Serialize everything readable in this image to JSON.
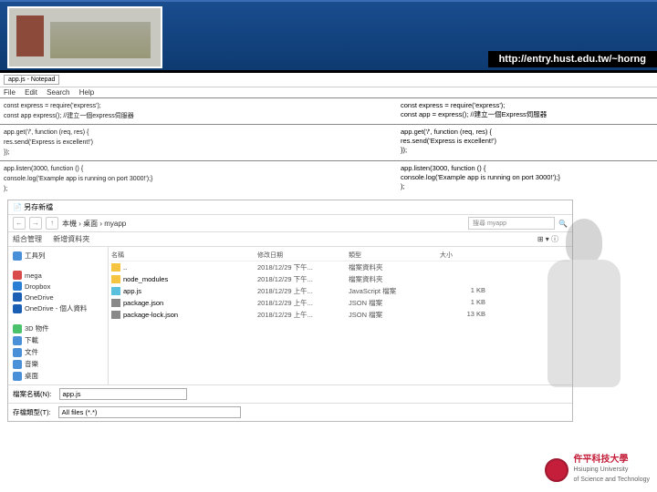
{
  "header": {
    "url": "http://entry.hust.edu.tw/~horng"
  },
  "editor": {
    "tab": "app.js - Notepad",
    "menu": [
      "File",
      "Edit",
      "Search",
      "Help"
    ],
    "codeLeft": [
      "const express = require('express');",
      "const app     express(); //建立一個express伺服器",
      "",
      "app.get('/', function (req, res) {",
      "  res.send('Express is excellent!')",
      "});",
      "",
      "app.listen(3000, function () {",
      "  console.log('Example app is running on port 3000!');}",
      ");"
    ],
    "codeRight": [
      "const express = require('express');",
      "const app = express(); //建立一個Express伺服器",
      "",
      "app.get('/', function (req, res) {",
      "  res.send('Express is excellent!')",
      "});",
      "",
      "app.listen(3000, function () {",
      "  console.log('Example app is running on port 3000!');}",
      ");"
    ]
  },
  "fe": {
    "title": "另存新檔",
    "breadcrumb": "本機 › 桌面 › myapp",
    "searchPlaceholder": "搜尋 myapp",
    "navItems": [
      "組合管理",
      "新增資料夾"
    ],
    "sidebar": [
      {
        "label": "工具列",
        "icon": "#4a90d9"
      },
      {
        "label": "mega",
        "icon": "#d94a4a"
      },
      {
        "label": "Dropbox",
        "icon": "#2a7fd4"
      },
      {
        "label": "OneDrive",
        "icon": "#1a5fb4"
      },
      {
        "label": "OneDrive - 個人資料",
        "icon": "#1a5fb4"
      },
      {
        "label": "3D 物件",
        "icon": "#4ac26b"
      },
      {
        "label": "下載",
        "icon": "#4a90d9"
      },
      {
        "label": "文件",
        "icon": "#4a90d9"
      },
      {
        "label": "音樂",
        "icon": "#4a90d9"
      },
      {
        "label": "桌面",
        "icon": "#4a90d9"
      }
    ],
    "columns": [
      "名稱",
      "修改日期",
      "類型",
      "大小"
    ],
    "files": [
      {
        "name": "..",
        "date": "2018/12/29 下午...",
        "type": "檔案資料夾",
        "size": "",
        "icon": "#f5c542"
      },
      {
        "name": "node_modules",
        "date": "2018/12/29 下午...",
        "type": "檔案資料夾",
        "size": "",
        "icon": "#f5c542"
      },
      {
        "name": "app.js",
        "date": "2018/12/29 上午...",
        "type": "JavaScript 檔案",
        "size": "1 KB",
        "icon": "#5bc0de"
      },
      {
        "name": "package.json",
        "date": "2018/12/29 上午...",
        "type": "JSON 檔案",
        "size": "1 KB",
        "icon": "#888"
      },
      {
        "name": "package-lock.json",
        "date": "2018/12/29 上午...",
        "type": "JSON 檔案",
        "size": "13 KB",
        "icon": "#888"
      }
    ],
    "filenameLabel": "檔案名稱(N):",
    "filenameValue": "app.js",
    "typeLabel": "存檔類型(T):",
    "typeValue": "All files (*.*)"
  },
  "university": {
    "cn": "仵平科技大學",
    "en": "Hsiuping University",
    "en2": "of Science and Technology"
  }
}
